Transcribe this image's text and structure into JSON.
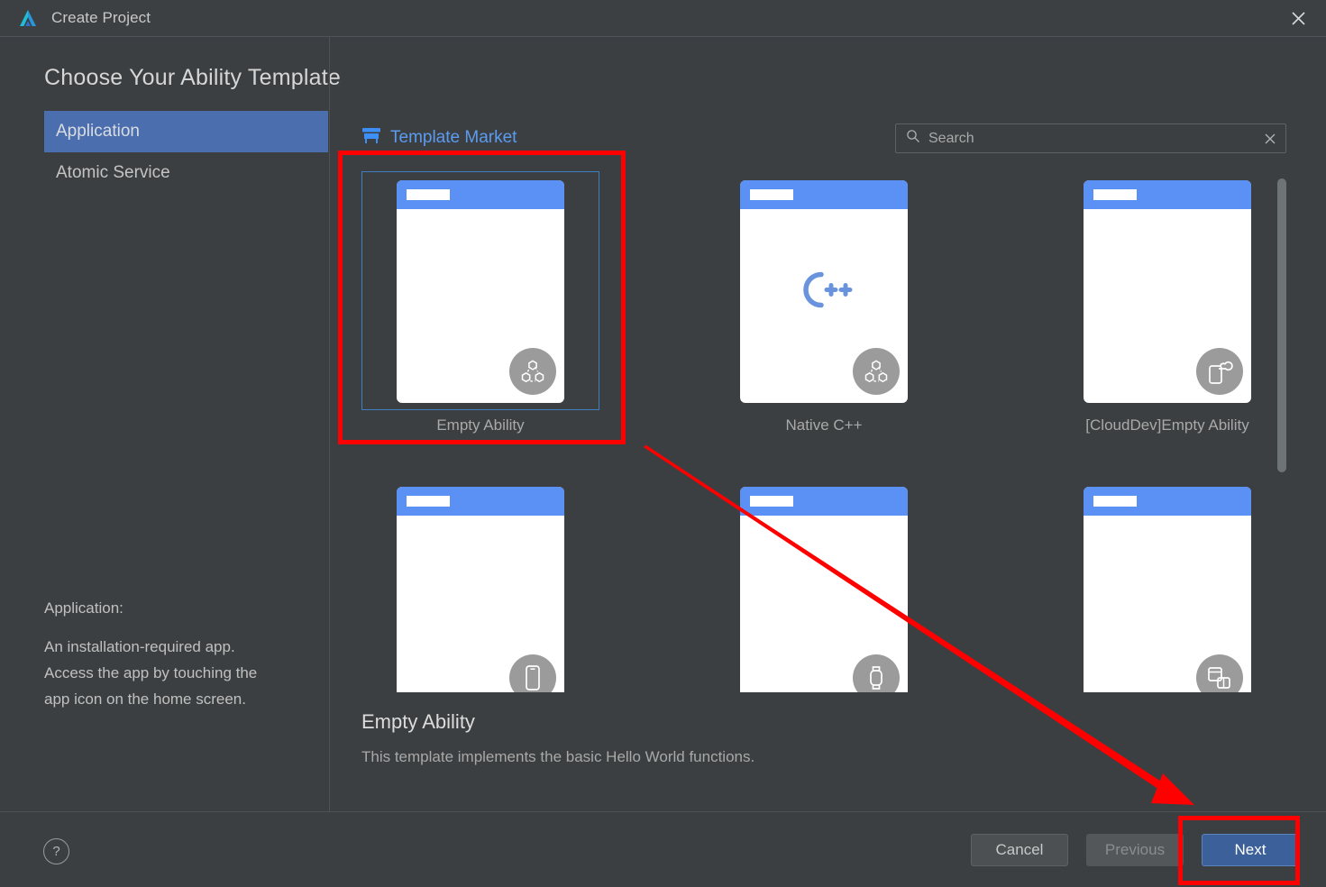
{
  "window": {
    "title": "Create Project",
    "logo_icon": "deveco-logo-icon",
    "close_icon": "close-icon"
  },
  "page": {
    "title": "Choose Your Ability Template"
  },
  "sidebar": {
    "items": [
      {
        "label": "Application",
        "selected": true
      },
      {
        "label": "Atomic Service",
        "selected": false
      }
    ],
    "description": {
      "heading": "Application:",
      "lines": [
        "An installation-required app.",
        "Access the app by touching the",
        "app icon on the home screen."
      ]
    }
  },
  "market_link": {
    "label": "Template Market",
    "icon": "template-market-icon",
    "color": "#5b9bf0"
  },
  "search": {
    "value": "",
    "placeholder": "Search",
    "search_icon": "search-icon",
    "clear_icon": "clear-icon"
  },
  "templates": [
    {
      "label": "Empty Ability",
      "selected": true,
      "badge_icon": "ability-hexagons-icon",
      "center_glyph": ""
    },
    {
      "label": "Native C++",
      "selected": false,
      "badge_icon": "ability-hexagons-icon",
      "center_glyph": "C++"
    },
    {
      "label": "[CloudDev]Empty Ability",
      "selected": false,
      "badge_icon": "phone-cloud-icon",
      "center_glyph": ""
    },
    {
      "label": "",
      "selected": false,
      "badge_icon": "phone-icon",
      "center_glyph": ""
    },
    {
      "label": "",
      "selected": false,
      "badge_icon": "watch-icon",
      "center_glyph": ""
    },
    {
      "label": "",
      "selected": false,
      "badge_icon": "tablet-split-icon",
      "center_glyph": ""
    }
  ],
  "detail": {
    "title": "Empty Ability",
    "description": "This template implements the basic Hello World functions."
  },
  "footer": {
    "help_icon": "help-icon",
    "help_label": "?",
    "buttons": [
      {
        "label": "Cancel",
        "style": "default",
        "disabled": false
      },
      {
        "label": "Previous",
        "style": "disabled",
        "disabled": true
      },
      {
        "label": "Next",
        "style": "primary",
        "disabled": false
      }
    ]
  },
  "annotations": {
    "highlight_color": "#ff0000",
    "boxes": [
      "empty-ability-card",
      "next-button"
    ],
    "arrow": "points from Empty Ability card to Next button"
  },
  "scrollbar": {
    "orientation": "vertical",
    "thumb_color": "#6e7375"
  }
}
